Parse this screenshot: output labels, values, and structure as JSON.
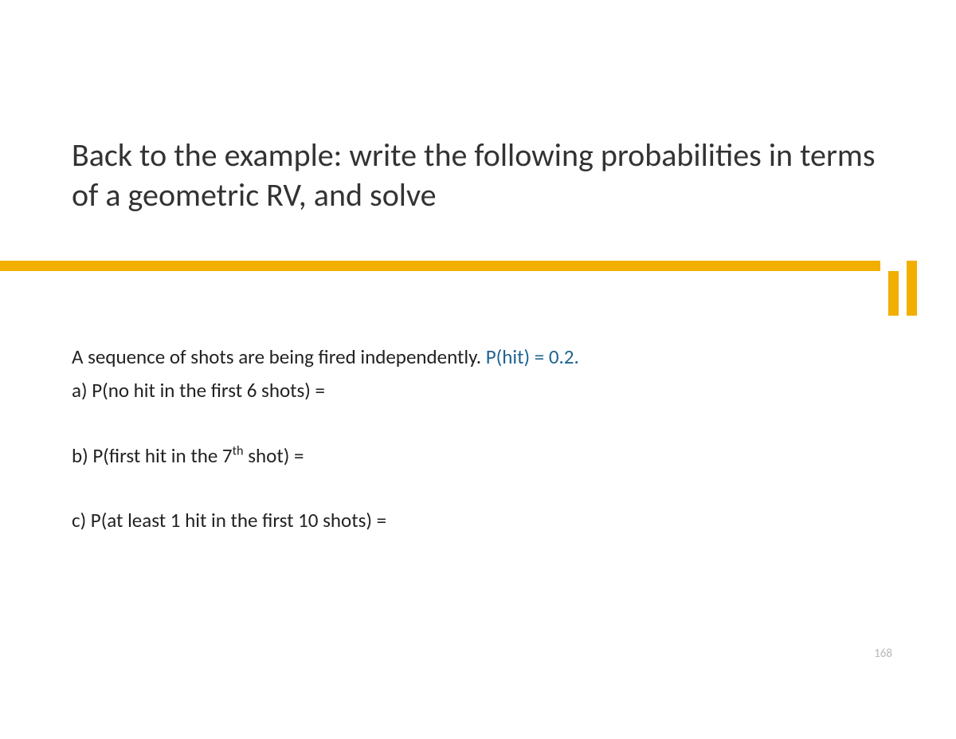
{
  "title": "Back to the example: write the following probabilities in terms of a geometric RV, and solve",
  "intro": {
    "text": "A sequence of shots are being fired independently. ",
    "phit": "P(hit) = 0.2."
  },
  "questions": {
    "a": "a) P(no hit in the first 6 shots) =",
    "b_prefix": "b) P(first hit in the 7",
    "b_sup": "th",
    "b_suffix": " shot) =",
    "c": "c) P(at least 1 hit in the first 10 shots) ="
  },
  "page_number": "168"
}
